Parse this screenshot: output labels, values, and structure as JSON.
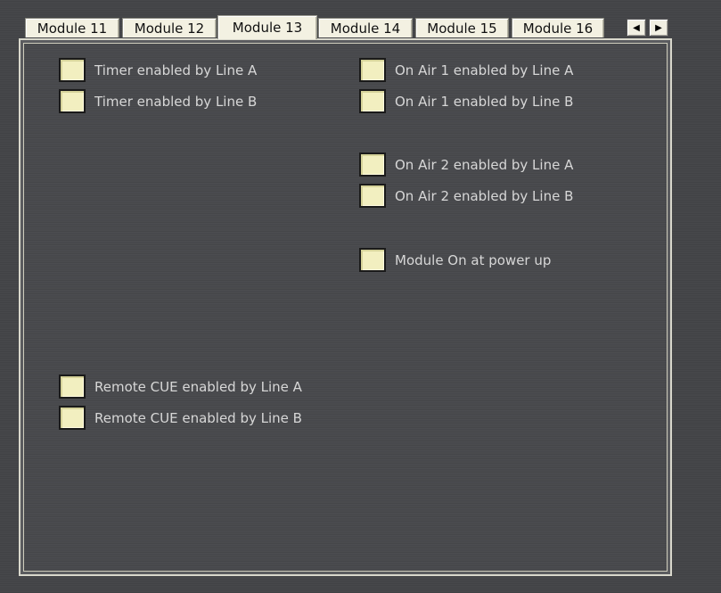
{
  "tabs": [
    {
      "label": "Module 11",
      "active": false
    },
    {
      "label": "Module 12",
      "active": false
    },
    {
      "label": "Module 13",
      "active": true
    },
    {
      "label": "Module 14",
      "active": false
    },
    {
      "label": "Module 15",
      "active": false
    },
    {
      "label": "Module 16",
      "active": false
    }
  ],
  "scroll": {
    "left_icon": "arrow-left-icon",
    "right_icon": "arrow-right-icon",
    "left_glyph": "◀",
    "right_glyph": "▶"
  },
  "options": {
    "timer_a": {
      "label": "Timer enabled by Line A",
      "checked": false
    },
    "timer_b": {
      "label": "Timer enabled by Line B",
      "checked": false
    },
    "onair1_a": {
      "label": "On Air 1 enabled by Line A",
      "checked": false
    },
    "onair1_b": {
      "label": "On Air 1 enabled by Line B",
      "checked": false
    },
    "onair2_a": {
      "label": "On Air 2 enabled by Line A",
      "checked": false
    },
    "onair2_b": {
      "label": "On Air 2 enabled by Line B",
      "checked": false
    },
    "module_on": {
      "label": "Module On at power up",
      "checked": false
    },
    "remote_cue_a": {
      "label": "Remote CUE enabled by Line A",
      "checked": false
    },
    "remote_cue_b": {
      "label": "Remote CUE enabled by Line B",
      "checked": false
    }
  },
  "colors": {
    "checkbox_fill": "#f2efc0",
    "tab_bg": "#f3f1e2",
    "label_text": "#d7d7d7",
    "panel_bg": "#4a4b4e"
  }
}
